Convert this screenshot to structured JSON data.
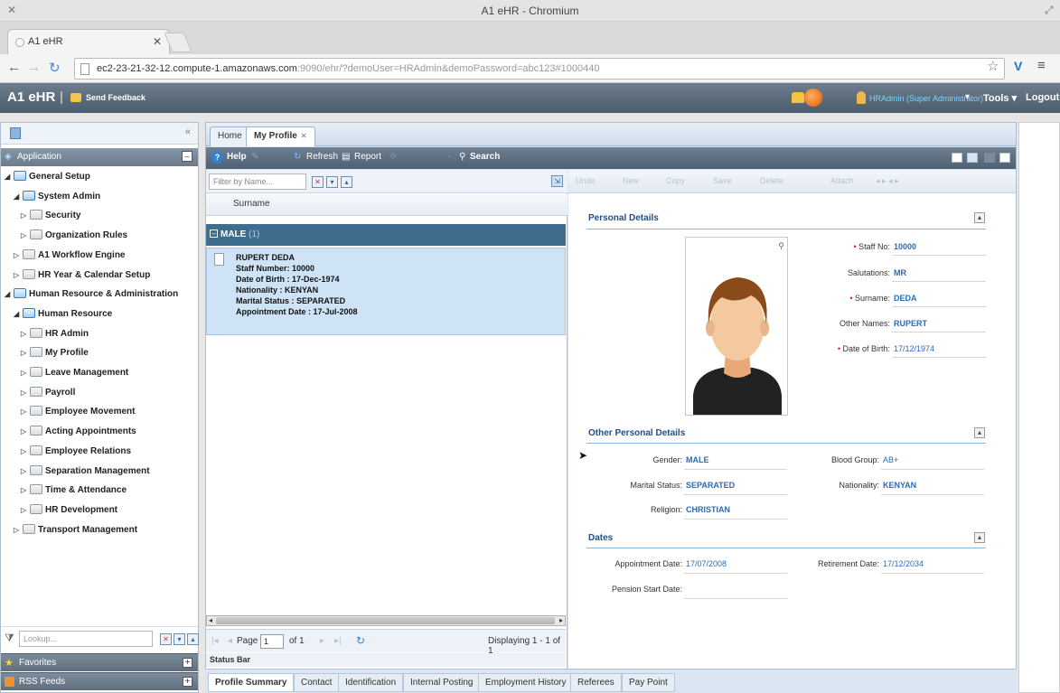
{
  "browser": {
    "window_title": "A1 eHR - Chromium",
    "tab_title": "A1 eHR",
    "url_host": "ec2-23-21-32-12.compute-1.amazonaws.com",
    "url_rest": ":9090/ehr/?demoUser=HRAdmin&demoPassword=abc123#1000440"
  },
  "header": {
    "app_title": "A1 eHR",
    "separator": "|",
    "send_feedback": "Send Feedback",
    "user": "HRAdmin (Super Administrator)",
    "tools": "Tools",
    "logout": "Logout"
  },
  "sidebar": {
    "application_label": "Application",
    "tree": [
      {
        "label": "General Setup",
        "expanded": true,
        "folder": "blue"
      },
      {
        "label": "System Admin",
        "expanded": true,
        "folder": "blue"
      },
      {
        "label": "Security",
        "expanded": false,
        "folder": "plain"
      },
      {
        "label": "Organization Rules",
        "expanded": false,
        "folder": "plain"
      },
      {
        "label": "A1 Workflow Engine",
        "expanded": false,
        "folder": "plain"
      },
      {
        "label": "HR Year & Calendar Setup",
        "expanded": false,
        "folder": "plain"
      },
      {
        "label": "Human Resource & Administration",
        "expanded": true,
        "folder": "blue"
      },
      {
        "label": "Human Resource",
        "expanded": true,
        "folder": "blue"
      },
      {
        "label": "HR Admin",
        "expanded": false,
        "folder": "plain"
      },
      {
        "label": "My Profile",
        "expanded": false,
        "folder": "plain"
      },
      {
        "label": "Leave Management",
        "expanded": false,
        "folder": "plain"
      },
      {
        "label": "Payroll",
        "expanded": false,
        "folder": "plain"
      },
      {
        "label": "Employee Movement",
        "expanded": false,
        "folder": "plain"
      },
      {
        "label": "Acting Appointments",
        "expanded": false,
        "folder": "plain"
      },
      {
        "label": "Employee Relations",
        "expanded": false,
        "folder": "plain"
      },
      {
        "label": "Separation Management",
        "expanded": false,
        "folder": "plain"
      },
      {
        "label": "Time & Attendance",
        "expanded": false,
        "folder": "plain"
      },
      {
        "label": "HR Development",
        "expanded": false,
        "folder": "plain"
      },
      {
        "label": "Transport Management",
        "expanded": false,
        "folder": "plain"
      }
    ],
    "lookup_placeholder": "Lookup...",
    "favorites": "Favorites",
    "rss_feeds": "RSS Feeds"
  },
  "tabs": {
    "home": "Home",
    "my_profile": "My Profile"
  },
  "main_toolbar": {
    "help": "Help",
    "refresh": "Refresh",
    "report": "Report",
    "search": "Search"
  },
  "list": {
    "filter_placeholder": "Filter by Name...",
    "column_surname": "Surname",
    "group_label": "MALE",
    "group_count": "(1)",
    "record": {
      "name": "RUPERT DEDA",
      "staff_number": "Staff Number: 10000",
      "dob": "Date of Birth : 17-Dec-1974",
      "nationality": "Nationality : KENYAN",
      "marital": "Marital Status : SEPARATED",
      "appointment": "Appointment Date : 17-Jul-2008"
    },
    "pager": {
      "page_label": "Page",
      "page_value": "1",
      "of_label": "of 1",
      "displaying": "Displaying 1 - 1 of 1"
    },
    "status_bar": "Status Bar"
  },
  "detail": {
    "toolbar": [
      "Undo",
      "New",
      "Copy",
      "Save",
      "Delete",
      "Attach"
    ],
    "personal_details": {
      "title": "Personal Details",
      "staff_no_label": "Staff No:",
      "staff_no": "10000",
      "salutations_label": "Salutations:",
      "salutations": "MR",
      "surname_label": "Surname:",
      "surname": "DEDA",
      "other_names_label": "Other Names:",
      "other_names": "RUPERT",
      "dob_label": "Date of Birth:",
      "dob": "17/12/1974"
    },
    "other_personal": {
      "title": "Other Personal Details",
      "gender_label": "Gender:",
      "gender": "MALE",
      "blood_label": "Blood Group:",
      "blood": "AB+",
      "marital_label": "Marital Status:",
      "marital": "SEPARATED",
      "nationality_label": "Nationality:",
      "nationality": "KENYAN",
      "religion_label": "Religion:",
      "religion": "CHRISTIAN"
    },
    "dates": {
      "title": "Dates",
      "appointment_label": "Appointment Date:",
      "appointment": "17/07/2008",
      "retirement_label": "Retirement Date:",
      "retirement": "17/12/2034",
      "pension_label": "Pension Start Date:"
    }
  },
  "bottom_tabs": [
    "Profile Summary",
    "Contact",
    "Identification",
    "Internal Posting",
    "Employment History",
    "Referees",
    "Pay Point"
  ],
  "colors": {
    "header_bg": "#5a6a7b",
    "accent": "#2d6bb5",
    "group_bg": "#3f6d8e",
    "selection": "#cfe3f7"
  }
}
